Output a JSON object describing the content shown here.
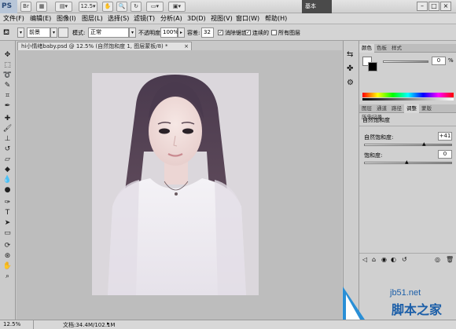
{
  "appbar": {
    "logo": "PS",
    "zoom": "12.5",
    "workspace": "基本",
    "minimize": "–",
    "maximize": "□",
    "close": "×"
  },
  "menu": [
    "文件(F)",
    "编辑(E)",
    "图像(I)",
    "图层(L)",
    "选择(S)",
    "滤镜(T)",
    "分析(A)",
    "3D(D)",
    "视图(V)",
    "窗口(W)",
    "帮助(H)"
  ],
  "options": {
    "source": "前景",
    "mode_label": "模式:",
    "mode_value": "正常",
    "opacity_label": "不透明度:",
    "opacity_value": "100%",
    "tolerance_label": "容差:",
    "tolerance_value": "32",
    "antialias_label": "消除锯齿",
    "contiguous_label": "连续的",
    "all_layers_label": "所有图层"
  },
  "document": {
    "tab_title": "hi小情绪baby.psd @ 12.5% (自然饱和度 1, 图层蒙板/8) *",
    "close": "×"
  },
  "status": {
    "zoom": "12.5%",
    "doc_size": "文档:34.4M/102.1M"
  },
  "panels": {
    "color_tabs": [
      "颜色",
      "色板",
      "样式"
    ],
    "color_value": "0",
    "color_unit": "%",
    "adjust_tabs": [
      "图层",
      "通道",
      "路径",
      "调整",
      "蒙版",
      "历史记录"
    ],
    "adjust_title": "自然饱和度",
    "vibrance_label": "自然饱和度:",
    "vibrance_value": "+41",
    "saturation_label": "饱和度:",
    "saturation_value": "0"
  },
  "watermark": {
    "url": "jb51.net",
    "name": "脚本之家"
  },
  "colors": {
    "panel_bg": "#d0d0d0",
    "canvas_bg": "#bdbdbd",
    "accent": "#2a4a78"
  }
}
